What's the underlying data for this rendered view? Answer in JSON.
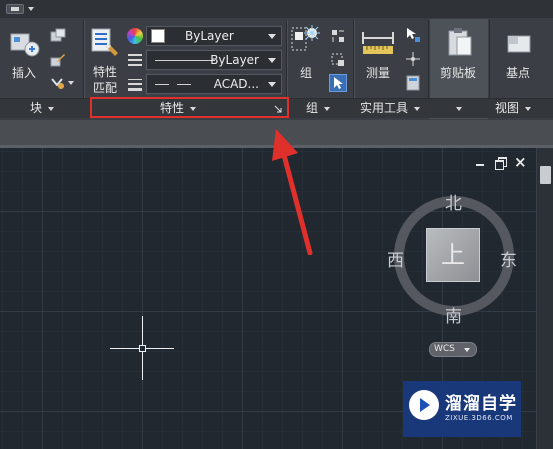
{
  "ribbon": {
    "panels": [
      {
        "title": "块"
      },
      {
        "title": "特性"
      },
      {
        "title": "组"
      },
      {
        "title": "实用工具"
      },
      {
        "title": ""
      },
      {
        "title": "视图"
      }
    ],
    "insert_label": "插入",
    "match_properties_label_line1": "特性",
    "match_properties_label_line2": "匹配",
    "group_label": "组",
    "measure_label": "测量",
    "clipboard_label": "剪贴板",
    "basepoint_label": "基点",
    "color_value": "ByLayer",
    "linetype_value": "ByLayer",
    "lineweight_value": "ACAD..."
  },
  "viewcube": {
    "north": "北",
    "south": "南",
    "west": "西",
    "east": "东",
    "face": "上",
    "coordinate_system": "WCS"
  },
  "window_controls": {
    "close_glyph": "×"
  },
  "watermark": {
    "name": "溜溜自学",
    "url": "ZIXUE.3D66.COM"
  },
  "colors": {
    "highlight": "#e0302c",
    "ribbon_bg": "#3b3f45",
    "canvas_bg": "#212830"
  }
}
